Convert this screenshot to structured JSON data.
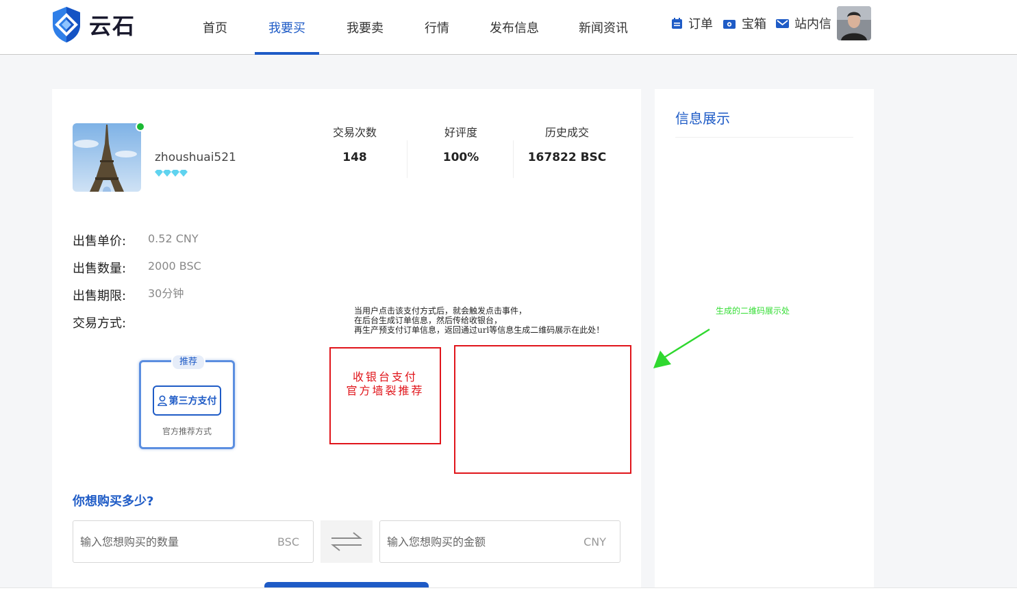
{
  "brand": {
    "name": "云石",
    "accent": "#1e5bc6"
  },
  "nav": {
    "items": [
      {
        "label": "首页",
        "active": false
      },
      {
        "label": "我要买",
        "active": true
      },
      {
        "label": "我要卖",
        "active": false
      },
      {
        "label": "行情",
        "active": false
      },
      {
        "label": "发布信息",
        "active": false
      },
      {
        "label": "新闻资讯",
        "active": false
      }
    ],
    "right": {
      "orders": "订单",
      "treasure": "宝箱",
      "messages": "站内信"
    }
  },
  "seller": {
    "username": "zhoushuai521",
    "online": true,
    "diamond_level": 4,
    "stats": [
      {
        "label": "交易次数",
        "value": "148"
      },
      {
        "label": "好评度",
        "value": "100%"
      },
      {
        "label": "历史成交",
        "value": "167822 BSC"
      }
    ]
  },
  "offer": {
    "price_label": "出售单价:",
    "price_value": "0.52 CNY",
    "quantity_label": "出售数量:",
    "quantity_value": "2000 BSC",
    "period_label": "出售期限:",
    "period_value": "30分钟",
    "method_label": "交易方式:"
  },
  "payment": {
    "badge": "推荐",
    "button": "第三方支付",
    "subtitle": "官方推荐方式"
  },
  "annotations": {
    "note_lines": [
      "当用户点击该支付方式后，就会触发点击事件，",
      "在后台生成订单信息，然后传给收银台，",
      "再生产预支付订单信息，返回通过url等信息生成二维码展示在此处！"
    ],
    "cashier_line1": "收银台支付",
    "cashier_line2": "官方墙裂推荐",
    "qr_note": "生成的二维码展示处",
    "colors": {
      "red": "#e0141a",
      "green": "#33dd33"
    }
  },
  "buy": {
    "title": "你想购买多少?",
    "qty_placeholder": "输入您想购买的数量",
    "qty_unit": "BSC",
    "amount_placeholder": "输入您想购买的金额",
    "amount_unit": "CNY"
  },
  "side": {
    "title": "信息展示"
  }
}
